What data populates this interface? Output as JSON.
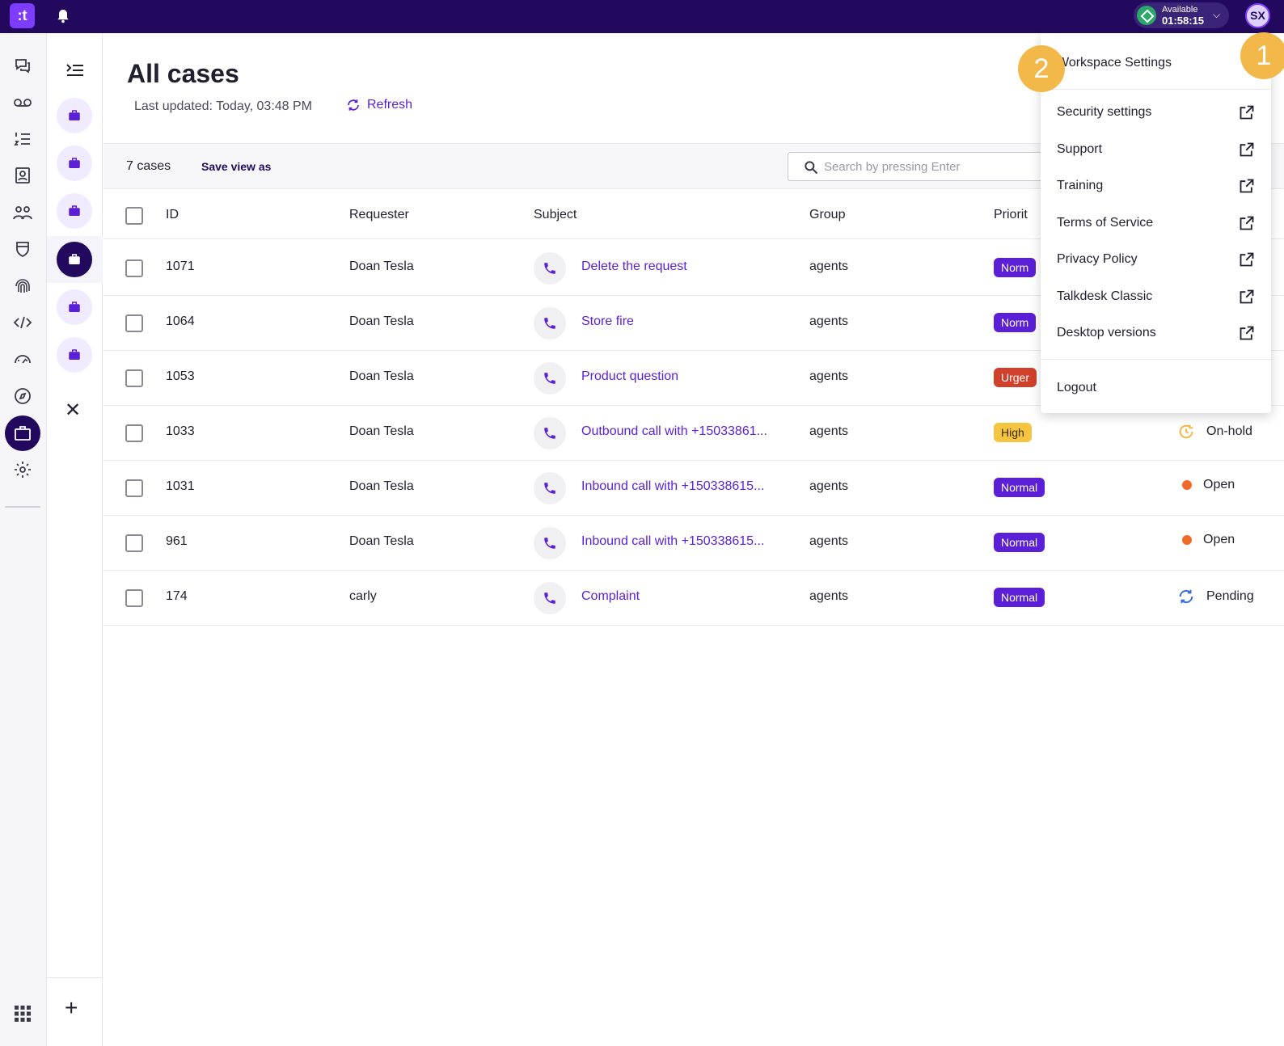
{
  "app": {
    "logo_text": ":t"
  },
  "topbar": {
    "status_label": "Available",
    "status_timer": "01:58:15",
    "avatar_initials": "SX"
  },
  "page": {
    "title": "All cases",
    "last_updated": "Last updated:  Today, 03:48 PM",
    "refresh_label": "Refresh"
  },
  "toolbar": {
    "case_count": "7 cases",
    "save_view_label": "Save view as",
    "search_placeholder": "Search by pressing Enter"
  },
  "table": {
    "headers": {
      "id": "ID",
      "requester": "Requester",
      "subject": "Subject",
      "group": "Group",
      "priority": "Priorit"
    },
    "rows": [
      {
        "id": "1071",
        "requester": "Doan Tesla",
        "subject": "Delete the request",
        "group": "agents",
        "priority": "Norm",
        "priority_type": "normal",
        "status": ""
      },
      {
        "id": "1064",
        "requester": "Doan Tesla",
        "subject": "Store fire",
        "group": "agents",
        "priority": "Norm",
        "priority_type": "normal",
        "status": ""
      },
      {
        "id": "1053",
        "requester": "Doan Tesla",
        "subject": "Product question",
        "group": "agents",
        "priority": "Urger",
        "priority_type": "urgent",
        "status": ""
      },
      {
        "id": "1033",
        "requester": "Doan Tesla",
        "subject": "Outbound call with +15033861...",
        "group": "agents",
        "priority": "High",
        "priority_type": "high",
        "status": "On-hold"
      },
      {
        "id": "1031",
        "requester": "Doan Tesla",
        "subject": "Inbound call with +150338615...",
        "group": "agents",
        "priority": "Normal",
        "priority_type": "normal",
        "status": "Open"
      },
      {
        "id": "961",
        "requester": "Doan Tesla",
        "subject": "Inbound call with +150338615...",
        "group": "agents",
        "priority": "Normal",
        "priority_type": "normal",
        "status": "Open"
      },
      {
        "id": "174",
        "requester": "carly",
        "subject": "Complaint",
        "group": "agents",
        "priority": "Normal",
        "priority_type": "normal",
        "status": "Pending"
      }
    ]
  },
  "menu": {
    "header": "Workspace Settings",
    "items": [
      {
        "label": "Security settings"
      },
      {
        "label": "Support"
      },
      {
        "label": "Training"
      },
      {
        "label": "Terms of Service"
      },
      {
        "label": "Privacy Policy"
      },
      {
        "label": "Talkdesk Classic"
      },
      {
        "label": "Desktop versions"
      }
    ],
    "logout": "Logout"
  },
  "steps": {
    "one": "1",
    "two": "2"
  },
  "colors": {
    "topbar": "#22095e",
    "accent": "#5a1fd6",
    "brand": "#7d3cff",
    "urgent": "#d0402b",
    "high": "#f5c542",
    "open": "#f06b2a",
    "step_badge": "#f2b94a"
  }
}
